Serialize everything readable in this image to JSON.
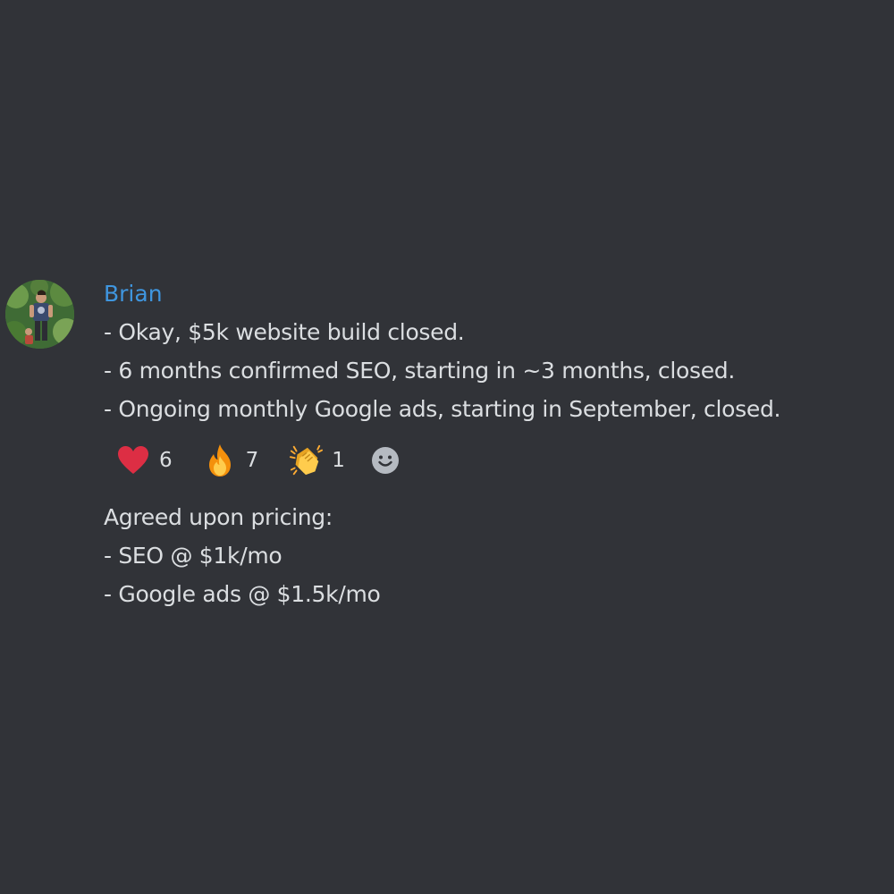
{
  "message": {
    "author": "Brian",
    "lines": [
      "- Okay, $5k website build closed.",
      "- 6 months confirmed SEO, starting in ~3 months, closed.",
      "- Ongoing monthly Google ads, starting in September, closed."
    ],
    "reactions": [
      {
        "icon": "heart-icon",
        "count": "6"
      },
      {
        "icon": "fire-icon",
        "count": "7"
      },
      {
        "icon": "clap-icon",
        "count": "1"
      }
    ],
    "pricing_lines": [
      "Agreed upon pricing:",
      "- SEO @ $1k/mo",
      "- Google ads @ $1.5k/mo"
    ]
  },
  "colors": {
    "background": "#313338",
    "author": "#3f96df",
    "text": "#dbdee1"
  }
}
